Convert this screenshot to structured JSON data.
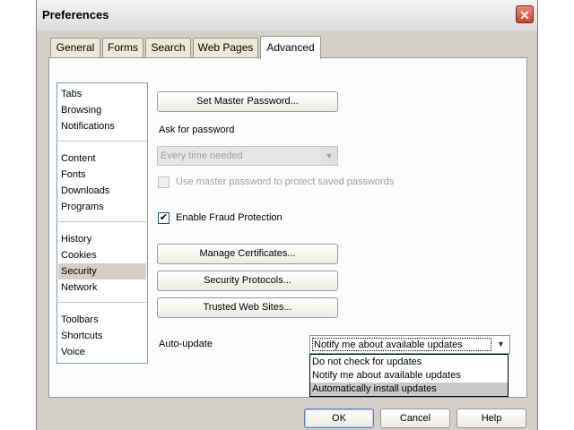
{
  "window": {
    "title": "Preferences",
    "close_glyph": "✕"
  },
  "tabs": [
    {
      "label": "General"
    },
    {
      "label": "Forms"
    },
    {
      "label": "Search"
    },
    {
      "label": "Web Pages"
    },
    {
      "label": "Advanced",
      "active": true
    }
  ],
  "sidebar": {
    "items": [
      {
        "label": "Tabs"
      },
      {
        "label": "Browsing"
      },
      {
        "label": "Notifications"
      },
      {
        "label": "Content"
      },
      {
        "label": "Fonts"
      },
      {
        "label": "Downloads"
      },
      {
        "label": "Programs"
      },
      {
        "label": "History"
      },
      {
        "label": "Cookies"
      },
      {
        "label": "Security",
        "selected": true
      },
      {
        "label": "Network"
      },
      {
        "label": "Toolbars"
      },
      {
        "label": "Shortcuts"
      },
      {
        "label": "Voice"
      }
    ]
  },
  "security": {
    "set_master_password_label": "Set Master Password...",
    "ask_for_password_label": "Ask for password",
    "ask_for_password_value": "Every time needed",
    "use_master_password_label": "Use master password to protect saved passwords",
    "use_master_password_checked": false,
    "fraud_protection_label": "Enable Fraud Protection",
    "fraud_protection_checked": true,
    "check_glyph": "✔",
    "manage_certificates_label": "Manage Certificates...",
    "security_protocols_label": "Security Protocols...",
    "trusted_web_sites_label": "Trusted Web Sites...",
    "auto_update_label": "Auto-update",
    "auto_update_value": "Notify me about available updates",
    "auto_update_options": [
      {
        "label": "Do not check for updates"
      },
      {
        "label": "Notify me about available updates"
      },
      {
        "label": "Automatically install updates",
        "highlighted": true
      }
    ]
  },
  "footer": {
    "ok_label": "OK",
    "cancel_label": "Cancel",
    "help_label": "Help"
  },
  "icons": {
    "dropdown_arrow": "▼"
  },
  "colors": {
    "window_bg": "#d4d0c8",
    "panel_bg": "#fcfcfe",
    "selection_bg": "#d4d0c8",
    "close_button": "#c7452b"
  }
}
